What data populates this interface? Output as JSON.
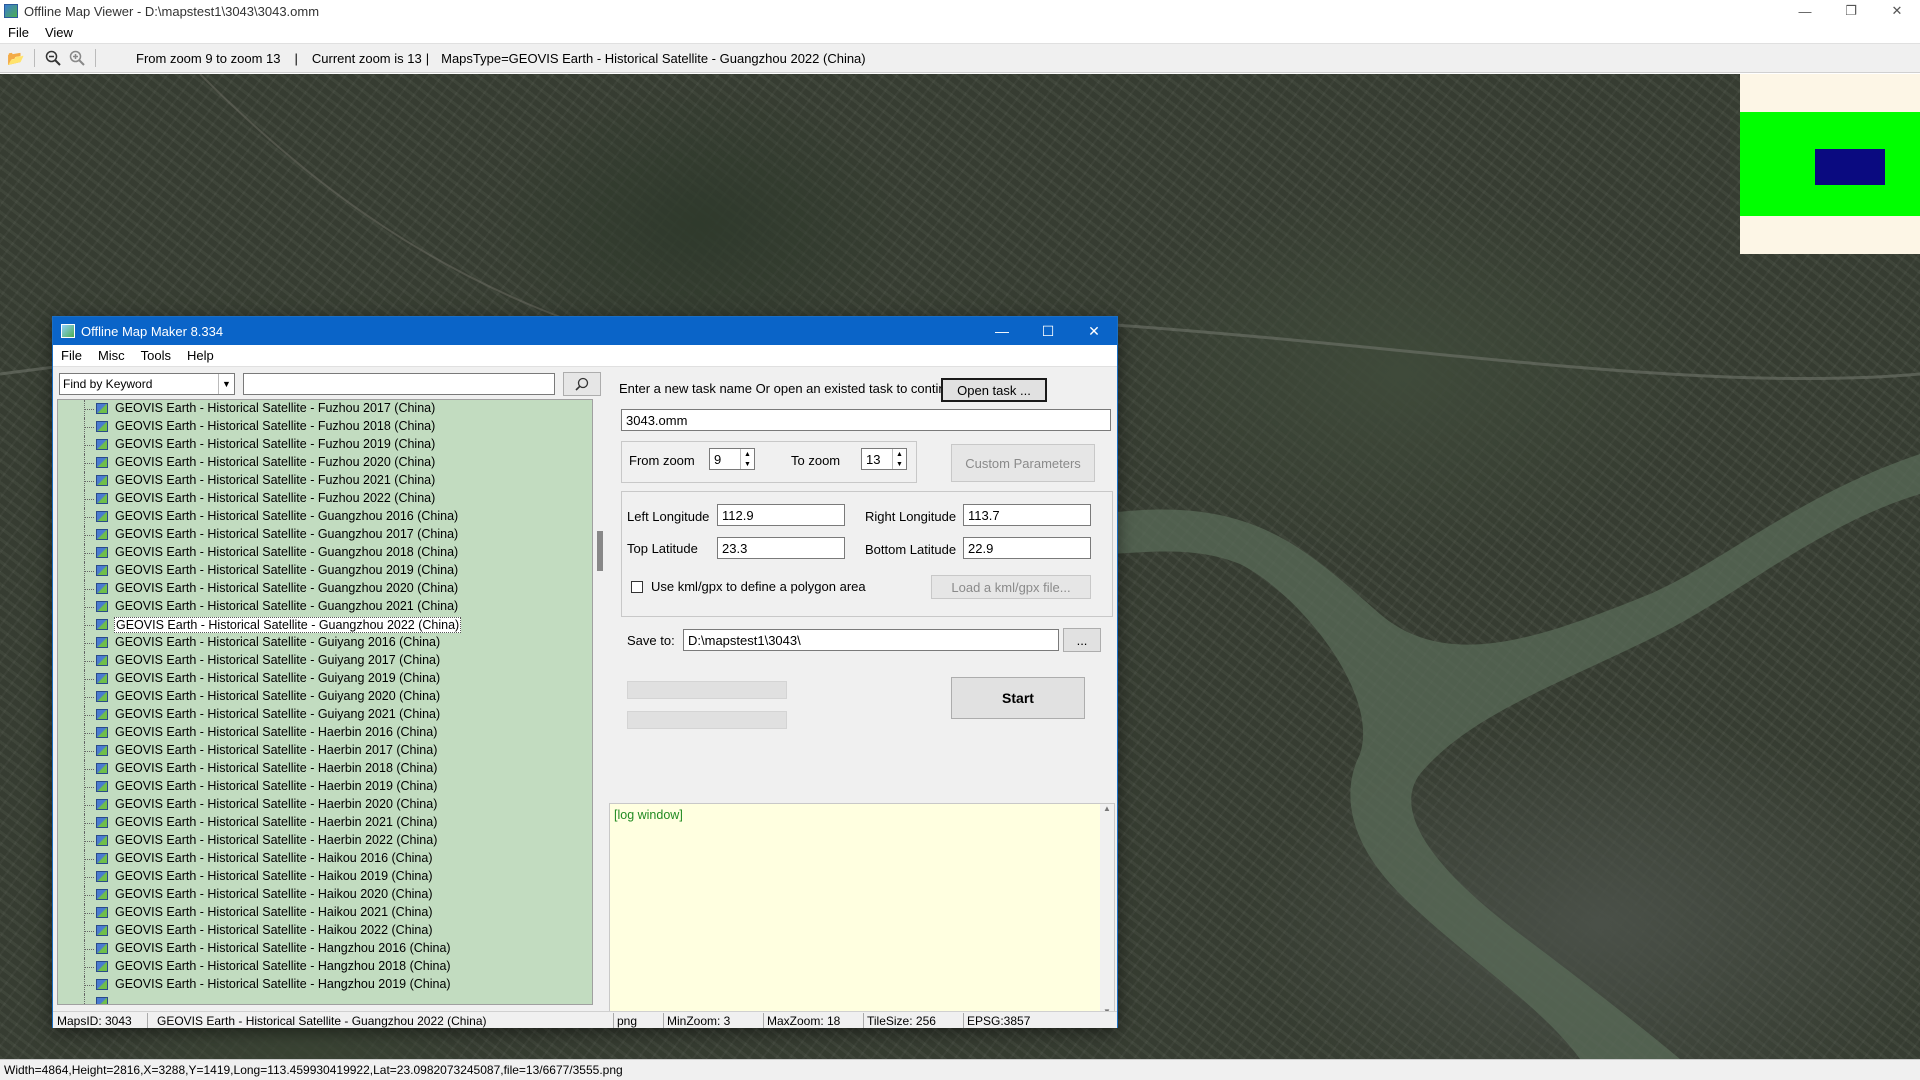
{
  "viewer": {
    "title": "Offline Map Viewer - D:\\mapstest1\\3043\\3043.omm",
    "menu": [
      "File",
      "View"
    ],
    "toolbar": {
      "zoom_range": "From zoom 9 to zoom 13",
      "current_zoom": "Current zoom is 13",
      "maps_type": "MapsType=GEOVIS Earth - Historical Satellite - Guangzhou 2022 (China)"
    },
    "status": "Width=4864,Height=2816,X=3288,Y=1419,Long=113.459930419922,Lat=23.0982073245087,file=13/6677/3555.png",
    "overview_colors": {
      "bg": "#fdf6e6",
      "green": "#00ff00",
      "blue": "#0a0a80"
    }
  },
  "dialog": {
    "title": "Offline Map Maker 8.334",
    "menu": [
      "File",
      "Misc",
      "Tools",
      "Help"
    ],
    "search": {
      "mode": "Find by Keyword",
      "value": ""
    },
    "tree_items": [
      "GEOVIS Earth - Historical Satellite - Fuzhou 2017 (China)",
      "GEOVIS Earth - Historical Satellite - Fuzhou 2018 (China)",
      "GEOVIS Earth - Historical Satellite - Fuzhou 2019 (China)",
      "GEOVIS Earth - Historical Satellite - Fuzhou 2020 (China)",
      "GEOVIS Earth - Historical Satellite - Fuzhou 2021 (China)",
      "GEOVIS Earth - Historical Satellite - Fuzhou 2022 (China)",
      "GEOVIS Earth - Historical Satellite - Guangzhou 2016 (China)",
      "GEOVIS Earth - Historical Satellite - Guangzhou 2017 (China)",
      "GEOVIS Earth - Historical Satellite - Guangzhou 2018 (China)",
      "GEOVIS Earth - Historical Satellite - Guangzhou 2019 (China)",
      "GEOVIS Earth - Historical Satellite - Guangzhou 2020 (China)",
      "GEOVIS Earth - Historical Satellite - Guangzhou 2021 (China)",
      "GEOVIS Earth - Historical Satellite - Guangzhou 2022 (China)",
      "GEOVIS Earth - Historical Satellite - Guiyang 2016 (China)",
      "GEOVIS Earth - Historical Satellite - Guiyang 2017 (China)",
      "GEOVIS Earth - Historical Satellite - Guiyang 2019 (China)",
      "GEOVIS Earth - Historical Satellite - Guiyang 2020 (China)",
      "GEOVIS Earth - Historical Satellite - Guiyang 2021 (China)",
      "GEOVIS Earth - Historical Satellite - Haerbin 2016 (China)",
      "GEOVIS Earth - Historical Satellite - Haerbin 2017 (China)",
      "GEOVIS Earth - Historical Satellite - Haerbin 2018 (China)",
      "GEOVIS Earth - Historical Satellite - Haerbin 2019 (China)",
      "GEOVIS Earth - Historical Satellite - Haerbin 2020 (China)",
      "GEOVIS Earth - Historical Satellite - Haerbin 2021 (China)",
      "GEOVIS Earth - Historical Satellite - Haerbin 2022 (China)",
      "GEOVIS Earth - Historical Satellite - Haikou 2016 (China)",
      "GEOVIS Earth - Historical Satellite - Haikou 2019 (China)",
      "GEOVIS Earth - Historical Satellite - Haikou 2020 (China)",
      "GEOVIS Earth - Historical Satellite - Haikou 2021 (China)",
      "GEOVIS Earth - Historical Satellite - Haikou 2022 (China)",
      "GEOVIS Earth - Historical Satellite - Hangzhou 2016 (China)",
      "GEOVIS Earth - Historical Satellite - Hangzhou 2018 (China)",
      "GEOVIS Earth - Historical Satellite - Hangzhou 2019 (China)"
    ],
    "selected_item": "GEOVIS Earth - Historical Satellite - Guangzhou 2022 (China)",
    "task": {
      "prompt": "Enter a new task name Or open an existed task to continue:",
      "open_button": "Open task ...",
      "name": "3043.omm"
    },
    "zoom": {
      "from_label": "From zoom",
      "from_value": "9",
      "to_label": "To zoom",
      "to_value": "13",
      "custom_button": "Custom Parameters"
    },
    "bounds": {
      "left_lon_label": "Left Longitude",
      "left_lon": "112.9",
      "right_lon_label": "Right Longitude",
      "right_lon": "113.7",
      "top_lat_label": "Top Latitude",
      "top_lat": "23.3",
      "bottom_lat_label": "Bottom Latitude",
      "bottom_lat": "22.9",
      "kml_checkbox_label": "Use kml/gpx to define a polygon area",
      "kml_button": "Load a kml/gpx file..."
    },
    "save": {
      "label": "Save to:",
      "path": "D:\\mapstest1\\3043\\",
      "browse": "..."
    },
    "start_button": "Start",
    "log_text": "[log window]",
    "status": {
      "maps_id": "MapsID: 3043",
      "maps_name": "GEOVIS Earth - Historical Satellite - Guangzhou 2022 (China)",
      "format": "png",
      "min_zoom": "MinZoom: 3",
      "max_zoom": "MaxZoom: 18",
      "tile_size": "TileSize: 256",
      "epsg": "EPSG:3857"
    }
  }
}
